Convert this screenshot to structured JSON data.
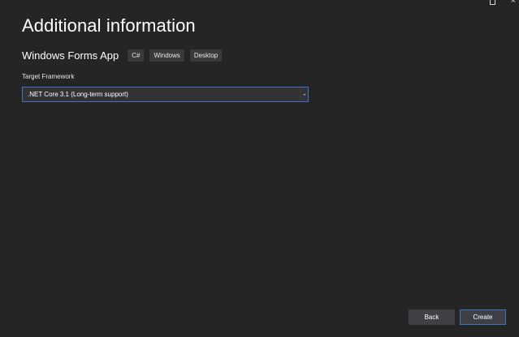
{
  "window": {
    "controls": [
      "restore-icon",
      "close-icon"
    ],
    "close_glyph": "×"
  },
  "header": {
    "title": "Additional information"
  },
  "template": {
    "name": "Windows Forms App",
    "tags": [
      "C#",
      "Windows",
      "Desktop"
    ]
  },
  "form": {
    "target_framework_label": "Target Framework",
    "target_framework_value": ".NET Core 3.1 (Long-term support)"
  },
  "footer": {
    "back_label": "Back",
    "create_label": "Create"
  },
  "colors": {
    "background": "#252526",
    "accent_border": "#3e74c2",
    "button_bg": "#3f3f46",
    "tag_bg": "#3a3a3c"
  }
}
